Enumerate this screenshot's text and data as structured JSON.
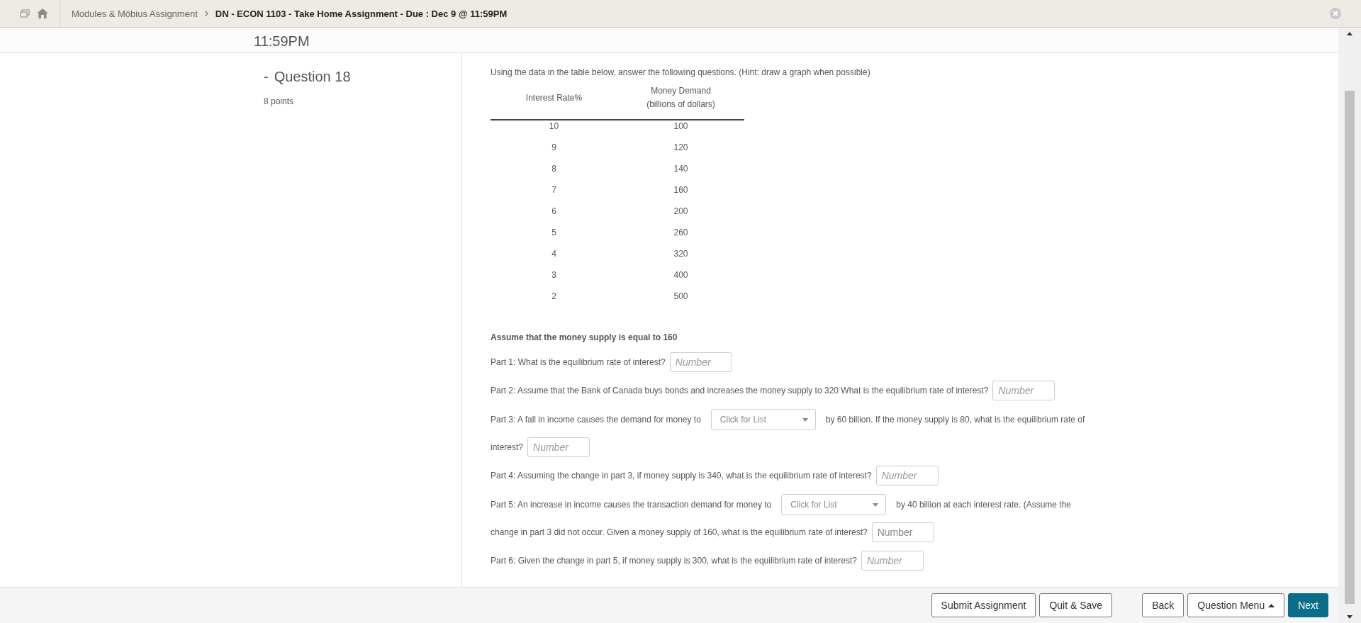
{
  "breadcrumb": {
    "items": [
      "Modules & Möbius Assignment",
      "DN - ECON 1103 - Take Home Assignment - Due : Dec 9 @ 11:59PM"
    ]
  },
  "header": {
    "title": "11:59PM"
  },
  "question": {
    "title": "Question 18",
    "toggle": "-",
    "points": "8 points"
  },
  "intro": "Using the data in the table below, answer the following questions. (Hint: draw a graph when possible)",
  "table": {
    "columns": [
      "Interest Rate%",
      "Money Demand\n(billions of dollars)"
    ],
    "rows": [
      [
        "10",
        "100"
      ],
      [
        "9",
        "120"
      ],
      [
        "8",
        "140"
      ],
      [
        "7",
        "160"
      ],
      [
        "6",
        "200"
      ],
      [
        "5",
        "260"
      ],
      [
        "4",
        "320"
      ],
      [
        "3",
        "400"
      ],
      [
        "2",
        "500"
      ]
    ]
  },
  "assumption": "Assume that the money supply is equal to 160",
  "parts": [
    [
      {
        "kind": "text",
        "text": "Part 1: What is the equilibrium rate of interest?"
      },
      {
        "kind": "number",
        "placeholder": "Number",
        "italic": true
      }
    ],
    [
      {
        "kind": "text",
        "text": "Part 2: Assume that the Bank of Canada buys bonds and increases the money supply to 320 What is the equilibrium rate of interest?"
      },
      {
        "kind": "number",
        "placeholder": "Number",
        "italic": true
      }
    ],
    [
      {
        "kind": "text",
        "text": "Part 3: A fall in income causes the demand for money to"
      },
      {
        "kind": "select",
        "placeholder": "Click for List"
      },
      {
        "kind": "text",
        "text": "by 60 billion. If the money supply is 80, what is the equilibrium rate of"
      },
      {
        "kind": "text",
        "text": "interest?"
      },
      {
        "kind": "number",
        "placeholder": "Number",
        "italic": true
      }
    ],
    [
      {
        "kind": "text",
        "text": "Part 4: Assuming the change in part 3, if money supply is 340, what is the equilibrium rate of interest?"
      },
      {
        "kind": "number",
        "placeholder": "Number",
        "italic": true
      }
    ],
    [
      {
        "kind": "text",
        "text": "Part 5: An increase in income causes the transaction demand for money to"
      },
      {
        "kind": "select",
        "placeholder": "Click for List"
      },
      {
        "kind": "text",
        "text": "by 40 billion at each interest rate. (Assume the"
      },
      {
        "kind": "text",
        "text": "change in part 3 did not occur. Given a money supply of 160, what is the equilibrium rate of interest?"
      },
      {
        "kind": "number",
        "placeholder": "Number",
        "italic": false
      }
    ],
    [
      {
        "kind": "text",
        "text": "Part 6: Given the change in part 5, if money supply is 300, what is the equilibrium rate of interest?"
      },
      {
        "kind": "number",
        "placeholder": "Number",
        "italic": true
      }
    ]
  ],
  "footer": {
    "left_buttons": [
      "Submit Assignment",
      "Quit & Save"
    ],
    "right_buttons": [
      {
        "label": "Back",
        "kind": "plain"
      },
      {
        "label": "Question Menu",
        "kind": "menu"
      },
      {
        "label": "Next",
        "kind": "primary"
      }
    ]
  }
}
